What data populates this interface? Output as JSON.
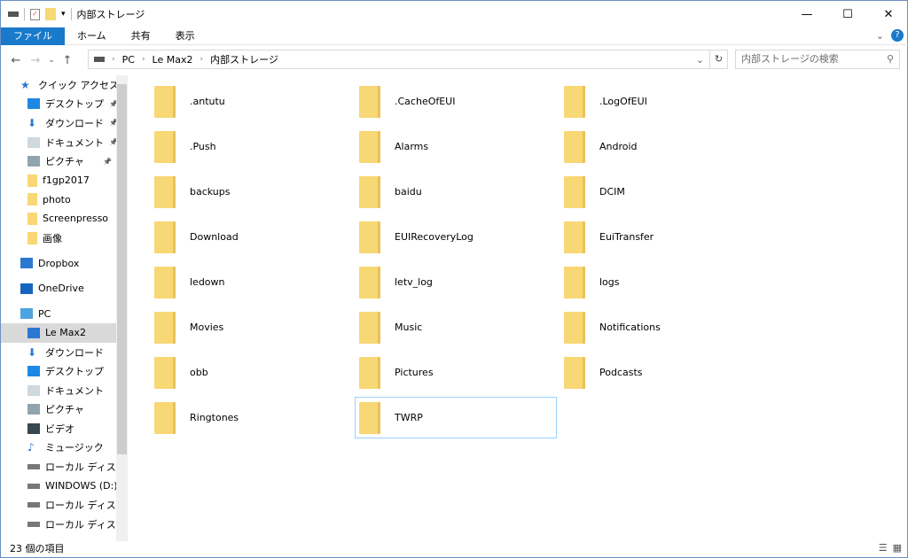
{
  "window": {
    "title": "内部ストレージ",
    "minimize": "—",
    "maximize": "☐",
    "close": "✕"
  },
  "ribbon": {
    "tabs": [
      "ファイル",
      "ホーム",
      "共有",
      "表示"
    ],
    "expand": "⌄",
    "help": "?"
  },
  "nav": {
    "back": "←",
    "forward": "→",
    "recent": "⌄",
    "up": "↑",
    "breadcrumb": [
      "PC",
      "Le Max2",
      "内部ストレージ"
    ],
    "dropdown": "⌄",
    "refresh": "↻",
    "search_placeholder": "内部ストレージの検索",
    "search_icon": "⚲"
  },
  "sidebar": {
    "items": [
      {
        "label": "クイック アクセス",
        "icon": "star",
        "indent": 1,
        "color": "#2b78d0"
      },
      {
        "label": "デスクトップ",
        "icon": "desktop",
        "indent": 2,
        "pinned": true,
        "color": "#1e88e5"
      },
      {
        "label": "ダウンロード",
        "icon": "download",
        "indent": 2,
        "pinned": true,
        "color": "#2b78d0"
      },
      {
        "label": "ドキュメント",
        "icon": "document",
        "indent": 2,
        "pinned": true,
        "color": "#cfd8dc"
      },
      {
        "label": "ピクチャ",
        "icon": "pictures",
        "indent": 2,
        "pinned": true,
        "color": "#90a4ae"
      },
      {
        "label": "f1gp2017",
        "icon": "folder-synced",
        "indent": 2,
        "color": "#f8d775"
      },
      {
        "label": "photo",
        "icon": "folder",
        "indent": 2,
        "color": "#f8d775"
      },
      {
        "label": "Screenpresso",
        "icon": "folder",
        "indent": 2,
        "color": "#f8d775"
      },
      {
        "label": "画像",
        "icon": "folder",
        "indent": 2,
        "color": "#f8d775"
      },
      {
        "label": "Dropbox",
        "icon": "dropbox",
        "indent": 1,
        "gap": true,
        "color": "#2b78d0"
      },
      {
        "label": "OneDrive",
        "icon": "onedrive",
        "indent": 1,
        "gap": true,
        "color": "#1565c0"
      },
      {
        "label": "PC",
        "icon": "pc",
        "indent": 1,
        "gap": true,
        "color": "#4fa3e0"
      },
      {
        "label": "Le Max2",
        "icon": "phone",
        "indent": 2,
        "selected": true,
        "color": "#2b78d0"
      },
      {
        "label": "ダウンロード",
        "icon": "download",
        "indent": 2,
        "color": "#2b78d0"
      },
      {
        "label": "デスクトップ",
        "icon": "desktop",
        "indent": 2,
        "color": "#1e88e5"
      },
      {
        "label": "ドキュメント",
        "icon": "document",
        "indent": 2,
        "color": "#cfd8dc"
      },
      {
        "label": "ピクチャ",
        "icon": "pictures",
        "indent": 2,
        "color": "#90a4ae"
      },
      {
        "label": "ビデオ",
        "icon": "video",
        "indent": 2,
        "color": "#37474f"
      },
      {
        "label": "ミュージック",
        "icon": "music",
        "indent": 2,
        "color": "#2b78d0"
      },
      {
        "label": "ローカル ディスク (C",
        "icon": "drive",
        "indent": 2,
        "color": "#777777"
      },
      {
        "label": "WINDOWS (D:)",
        "icon": "drive",
        "indent": 2,
        "color": "#777777"
      },
      {
        "label": "ローカル ディスク (F:",
        "icon": "drive",
        "indent": 2,
        "color": "#777777"
      },
      {
        "label": "ローカル ディスク (G",
        "icon": "drive",
        "indent": 2,
        "color": "#777777"
      }
    ]
  },
  "folders": [
    ".antutu",
    ".CacheOfEUI",
    ".LogOfEUI",
    ".Push",
    "Alarms",
    "Android",
    "backups",
    "baidu",
    "DCIM",
    "Download",
    "EUIRecoveryLog",
    "EuiTransfer",
    "ledown",
    "letv_log",
    "logs",
    "Movies",
    "Music",
    "Notifications",
    "obb",
    "Pictures",
    "Podcasts",
    "Ringtones",
    "TWRP"
  ],
  "focused_folder": "TWRP",
  "status": {
    "count": "23 個の項目"
  },
  "colors": {
    "accent": "#1979ca",
    "folder": "#f8d775"
  }
}
